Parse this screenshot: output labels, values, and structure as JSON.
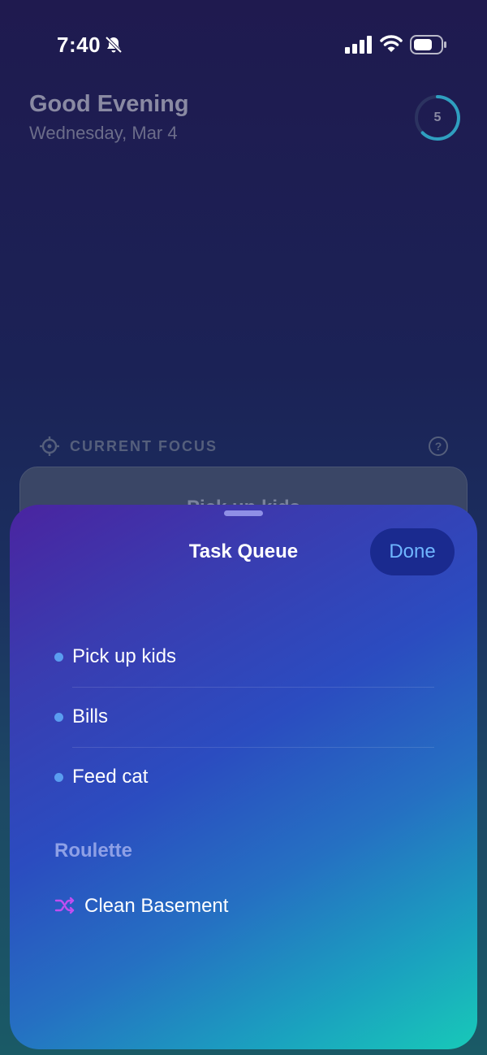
{
  "status_bar": {
    "time": "7:40",
    "icons": [
      "bell-off-icon",
      "signal-icon",
      "wifi-icon",
      "battery-icon"
    ]
  },
  "header": {
    "greeting": "Good Evening",
    "date": "Wednesday, Mar 4",
    "progress_count": "5"
  },
  "focus": {
    "label": "CURRENT FOCUS",
    "card_text": "Pick up kids"
  },
  "sheet": {
    "title": "Task Queue",
    "done_label": "Done",
    "tasks": [
      {
        "label": "Pick up kids"
      },
      {
        "label": "Bills"
      },
      {
        "label": "Feed cat"
      }
    ],
    "roulette_heading": "Roulette",
    "roulette_item": "Clean Basement"
  },
  "colors": {
    "accent": "#6fb6ff",
    "bullet": "#5a9df0",
    "shuffle": "#c04ef0",
    "ring": "#2f9fc0"
  }
}
